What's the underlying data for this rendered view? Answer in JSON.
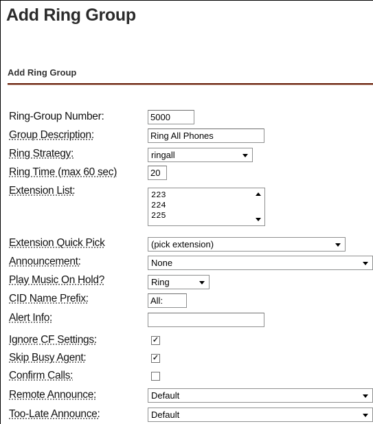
{
  "page": {
    "title": "Add Ring Group",
    "section_title": "Add Ring Group"
  },
  "form": {
    "ring_group_number": {
      "label": "Ring-Group Number:",
      "value": "5000"
    },
    "group_description": {
      "label": "Group Description:",
      "value": "Ring All Phones"
    },
    "ring_strategy": {
      "label": "Ring Strategy:",
      "selected": "ringall"
    },
    "ring_time": {
      "label": "Ring Time (max 60 sec)",
      "value": "20"
    },
    "extension_list": {
      "label": "Extension List:",
      "items": [
        "223",
        "224",
        "225"
      ]
    },
    "extension_quick_pick": {
      "label": "Extension Quick Pick",
      "selected": "(pick extension)"
    },
    "announcement": {
      "label": "Announcement:",
      "selected": "None"
    },
    "play_music_on_hold": {
      "label": "Play Music On Hold?",
      "selected": "Ring"
    },
    "cid_name_prefix": {
      "label": "CID Name Prefix:",
      "value": "All:"
    },
    "alert_info": {
      "label": "Alert Info:",
      "value": ""
    },
    "ignore_cf_settings": {
      "label": "Ignore CF Settings:",
      "checked": true,
      "mark": "✓"
    },
    "skip_busy_agent": {
      "label": "Skip Busy Agent:",
      "checked": true,
      "mark": "✓"
    },
    "confirm_calls": {
      "label": "Confirm Calls:",
      "checked": false,
      "mark": ""
    },
    "remote_announce": {
      "label": "Remote Announce:",
      "selected": "Default"
    },
    "too_late_announce": {
      "label": "Too-Late Announce:",
      "selected": "Default"
    }
  },
  "icons": {
    "dropdown": "chevron-down-icon",
    "scroll_up": "scroll-up-icon",
    "scroll_down": "scroll-down-icon",
    "check": "checkmark-icon"
  }
}
